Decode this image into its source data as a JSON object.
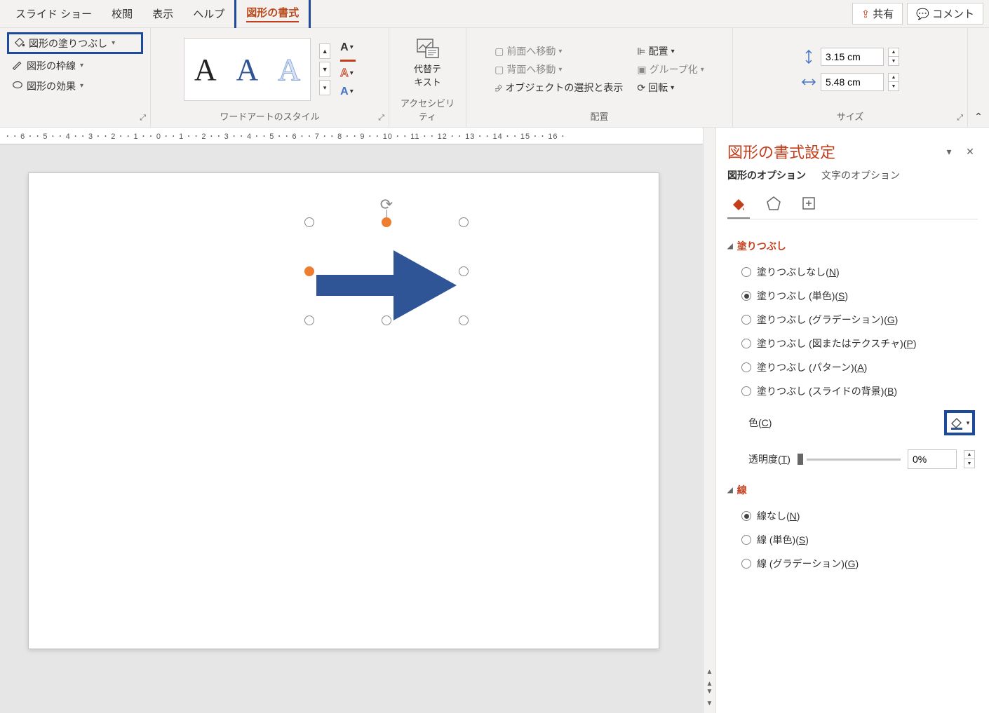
{
  "menubar": {
    "tabs": [
      "スライド ショー",
      "校閲",
      "表示",
      "ヘルプ",
      "図形の書式"
    ],
    "active_index": 4,
    "share": "共有",
    "comment": "コメント"
  },
  "ribbon": {
    "shape_styles": {
      "fill": "図形の塗りつぶし",
      "outline": "図形の枠線",
      "effects": "図形の効果"
    },
    "wordart": {
      "label": "ワードアートのスタイル"
    },
    "accessibility": {
      "button": "代替テ\nキスト",
      "label": "アクセシビリティ"
    },
    "arrange": {
      "front": "前面へ移動",
      "back": "背面へ移動",
      "select": "オブジェクトの選択と表示",
      "align": "配置",
      "group": "グループ化",
      "rotate": "回転",
      "label": "配置"
    },
    "size": {
      "height": "3.15 cm",
      "width": "5.48 cm",
      "label": "サイズ"
    }
  },
  "ruler": "･ ･ 6 ･ ･ 5 ･ ･ 4 ･ ･ 3 ･ ･ 2 ･ ･ 1 ･ ･ 0 ･ ･ 1 ･ ･ 2 ･ ･ 3 ･ ･ 4 ･ ･ 5 ･ ･ 6 ･ ･ 7 ･ ･ 8 ･ ･ 9 ･ ･ 10 ･ ･ 11 ･ ･ 12 ･ ･ 13 ･ ･ 14 ･ ･ 15 ･ ･ 16 ･",
  "pane": {
    "title": "図形の書式設定",
    "tabs": {
      "shape": "図形のオプション",
      "text": "文字のオプション"
    },
    "section_fill": "塗りつぶし",
    "fill_options": [
      {
        "label": "塗りつぶしなし(",
        "acc": "N",
        "tail": ")"
      },
      {
        "label": "塗りつぶし (単色)(",
        "acc": "S",
        "tail": ")"
      },
      {
        "label": "塗りつぶし (グラデーション)(",
        "acc": "G",
        "tail": ")"
      },
      {
        "label": "塗りつぶし (図またはテクスチャ)(",
        "acc": "P",
        "tail": ")"
      },
      {
        "label": "塗りつぶし (パターン)(",
        "acc": "A",
        "tail": ")"
      },
      {
        "label": "塗りつぶし (スライドの背景)(",
        "acc": "B",
        "tail": ")"
      }
    ],
    "fill_selected": 1,
    "color_label": "色(",
    "color_acc": "C",
    "color_tail": ")",
    "trans_label": "透明度(",
    "trans_acc": "T",
    "trans_tail": ")",
    "trans_value": "0%",
    "section_line": "線",
    "line_options": [
      {
        "label": "線なし(",
        "acc": "N",
        "tail": ")"
      },
      {
        "label": "線 (単色)(",
        "acc": "S",
        "tail": ")"
      },
      {
        "label": "線 (グラデーション)(",
        "acc": "G",
        "tail": ")"
      }
    ],
    "line_selected": 0
  }
}
